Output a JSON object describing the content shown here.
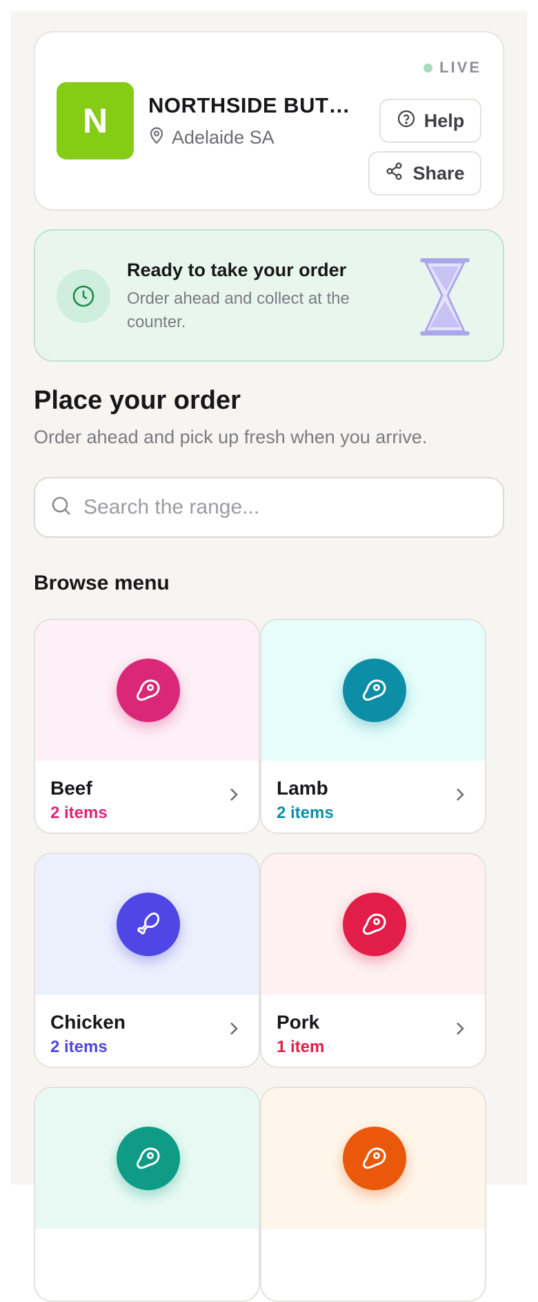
{
  "store": {
    "logo_letter": "N",
    "name": "NORTHSIDE BUTCHERS",
    "location": "Adelaide SA",
    "status": "LIVE",
    "help_label": "Help",
    "share_label": "Share",
    "brand_color": "#84cc16"
  },
  "order_status": {
    "title": "Ready to take your order",
    "description": "Order ahead and collect at the counter."
  },
  "main": {
    "title": "Place your order",
    "subtitle": "Order ahead and pick up fresh when you arrive.",
    "search_placeholder": "Search the range...",
    "browse_title": "Browse menu"
  },
  "categories": [
    {
      "name": "Beef",
      "count": "2 items",
      "icon": "steak-icon",
      "color": "#db2777",
      "bg": "#fdf0f6"
    },
    {
      "name": "Lamb",
      "count": "2 items",
      "icon": "steak-icon",
      "color": "#0e8ea6",
      "bg": "#e6fdfb"
    },
    {
      "name": "Chicken",
      "count": "2 items",
      "icon": "drumstick-icon",
      "color": "#4f46e5",
      "bg": "#ecf0fc"
    },
    {
      "name": "Pork",
      "count": "1 item",
      "icon": "steak-icon",
      "color": "#e11d48",
      "bg": "#fdf1f1"
    },
    {
      "name": "",
      "count": "",
      "icon": "steak-icon",
      "color": "#0f9b85",
      "bg": "#e8f9f3"
    },
    {
      "name": "",
      "count": "",
      "icon": "steak-icon",
      "color": "#ea580c",
      "bg": "#fef6ea"
    }
  ]
}
